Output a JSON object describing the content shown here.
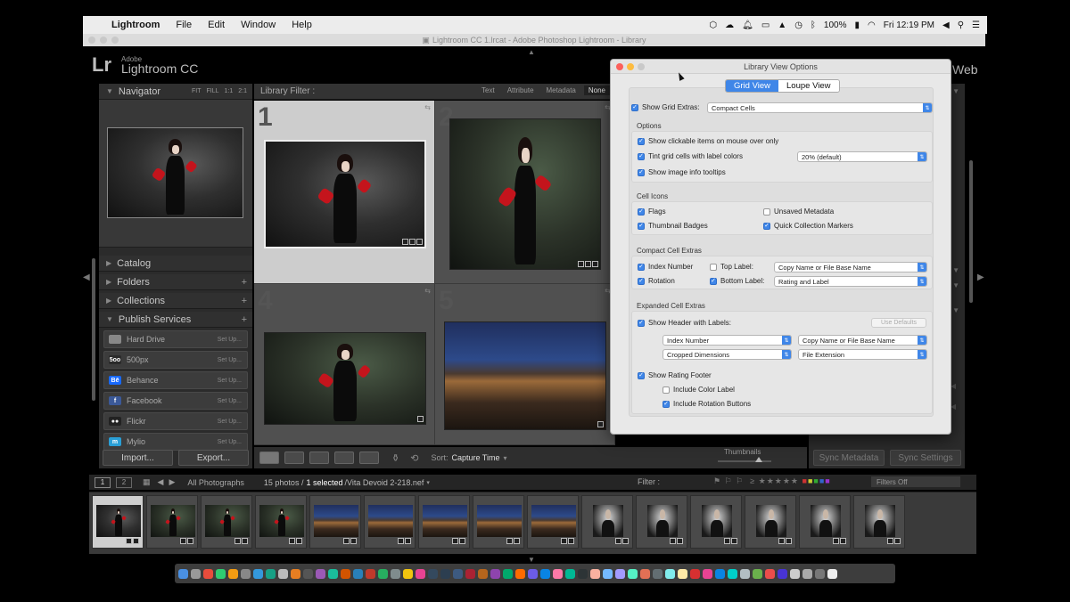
{
  "menubar": {
    "apple_icon": "apple-icon",
    "app": "Lightroom",
    "items": [
      "File",
      "Edit",
      "Window",
      "Help"
    ],
    "battery": "100%",
    "clock": "Fri 12:19 PM"
  },
  "window": {
    "title": "Lightroom CC 1.lrcat - Adobe Photoshop Lightroom - Library"
  },
  "identity": {
    "logo": "Lr",
    "adobe": "Adobe",
    "product": "Lightroom CC",
    "module_partial": "Web"
  },
  "navigator": {
    "title": "Navigator",
    "zoom_options": [
      "FIT",
      "FILL",
      "1:1",
      "2:1"
    ]
  },
  "left_panels": [
    {
      "label": "Catalog",
      "has_plus": false
    },
    {
      "label": "Folders",
      "has_plus": true
    },
    {
      "label": "Collections",
      "has_plus": true
    },
    {
      "label": "Publish Services",
      "has_plus": true
    }
  ],
  "publish_services": [
    {
      "label": "Hard Drive",
      "action": "Set Up...",
      "icon_text": "",
      "color": "#888888"
    },
    {
      "label": "500px",
      "action": "Set Up...",
      "icon_text": "5oo",
      "color": "#2a2a2a"
    },
    {
      "label": "Behance",
      "action": "Set Up...",
      "icon_text": "Bē",
      "color": "#1769ff"
    },
    {
      "label": "Facebook",
      "action": "Set Up...",
      "icon_text": "f",
      "color": "#3b5998"
    },
    {
      "label": "Flickr",
      "action": "Set Up...",
      "icon_text": "●●",
      "color": "#222222"
    },
    {
      "label": "Mylio",
      "action": "Set Up...",
      "icon_text": "m",
      "color": "#2a9fd6"
    }
  ],
  "left_buttons": {
    "import": "Import...",
    "export": "Export..."
  },
  "library_filter": {
    "label": "Library Filter :",
    "options": [
      "Text",
      "Attribute",
      "Metadata",
      "None"
    ],
    "active": "None"
  },
  "grid_cells": [
    {
      "num": "1",
      "photo": "dark",
      "selected": true
    },
    {
      "num": "2",
      "photo": "green",
      "selected": false
    },
    {
      "num": "4",
      "photo": "green",
      "selected": false
    },
    {
      "num": "5",
      "photo": "city",
      "selected": false
    }
  ],
  "toolbar": {
    "sort_label": "Sort:",
    "sort_value": "Capture Time",
    "thumbnails_label": "Thumbnails"
  },
  "right_buttons": {
    "sync_metadata": "Sync Metadata",
    "sync_settings": "Sync Settings"
  },
  "filmstrip_bar": {
    "page1": "1",
    "page2": "2",
    "source": "All Photographs",
    "count_prefix": "15 photos /",
    "count_selected": "1 selected",
    "filename": "/Vita Devoid 2-218.nef",
    "filter_label": "Filter :",
    "filter_value": "Filters Off"
  },
  "filmstrip": [
    {
      "photo": "dark",
      "selected": true
    },
    {
      "photo": "green",
      "selected": false
    },
    {
      "photo": "green",
      "selected": false
    },
    {
      "photo": "green",
      "selected": false
    },
    {
      "photo": "city",
      "selected": false
    },
    {
      "photo": "city",
      "selected": false
    },
    {
      "photo": "city",
      "selected": false
    },
    {
      "photo": "city",
      "selected": false
    },
    {
      "photo": "city",
      "selected": false
    },
    {
      "photo": "man",
      "selected": false
    },
    {
      "photo": "man",
      "selected": false
    },
    {
      "photo": "man",
      "selected": false
    },
    {
      "photo": "man",
      "selected": false
    },
    {
      "photo": "man",
      "selected": false
    },
    {
      "photo": "man",
      "selected": false
    }
  ],
  "dialog": {
    "title": "Library View Options",
    "tabs": [
      "Grid View",
      "Loupe View"
    ],
    "active_tab": "Grid View",
    "show_grid_extras": {
      "label": "Show Grid Extras:",
      "checked": true,
      "value": "Compact Cells"
    },
    "options_title": "Options",
    "options": [
      {
        "label": "Show clickable items on mouse over only",
        "checked": true
      },
      {
        "label": "Tint grid cells with label colors",
        "checked": true
      },
      {
        "label": "Show image info tooltips",
        "checked": true
      }
    ],
    "tint_value": "20% (default)",
    "cell_icons_title": "Cell Icons",
    "cell_icons": [
      {
        "label": "Flags",
        "checked": true
      },
      {
        "label": "Unsaved Metadata",
        "checked": false
      },
      {
        "label": "Thumbnail Badges",
        "checked": true
      },
      {
        "label": "Quick Collection Markers",
        "checked": true
      }
    ],
    "compact_title": "Compact Cell Extras",
    "compact": {
      "index_number": {
        "label": "Index Number",
        "checked": true
      },
      "top_label": {
        "label": "Top Label:",
        "checked": false,
        "value": "Copy Name or File Base Name"
      },
      "rotation": {
        "label": "Rotation",
        "checked": true
      },
      "bottom_label": {
        "label": "Bottom Label:",
        "checked": true,
        "value": "Rating and Label"
      }
    },
    "expanded_title": "Expanded Cell Extras",
    "expanded": {
      "show_header": {
        "label": "Show Header with Labels:",
        "checked": true
      },
      "use_defaults": "Use Defaults",
      "header_selects": [
        "Index Number",
        "Copy Name or File Base Name",
        "Cropped Dimensions",
        "File Extension"
      ],
      "rating_footer": {
        "label": "Show Rating Footer",
        "checked": true
      },
      "color_label": {
        "label": "Include Color Label",
        "checked": false
      },
      "rotation_buttons": {
        "label": "Include Rotation Buttons",
        "checked": true
      }
    }
  },
  "colors": {
    "accent": "#3f86e8",
    "panel": "#2b2b2b",
    "menubar": "#ececec"
  }
}
